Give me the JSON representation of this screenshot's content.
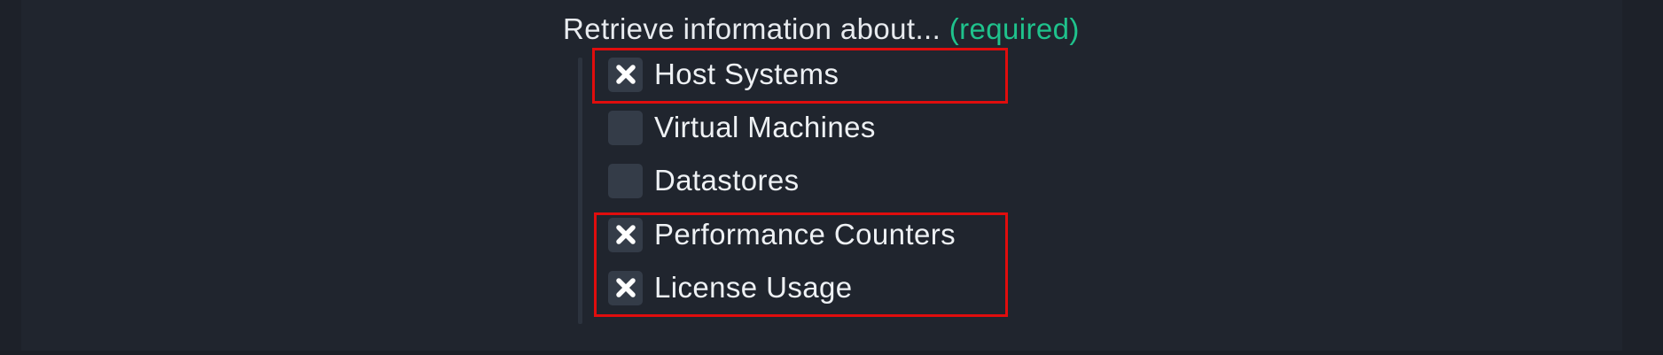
{
  "field": {
    "label": "Retrieve information about...",
    "required_tag": "(required)"
  },
  "options": [
    {
      "label": "Host Systems",
      "checked": true
    },
    {
      "label": "Virtual Machines",
      "checked": false
    },
    {
      "label": "Datastores",
      "checked": false
    },
    {
      "label": "Performance Counters",
      "checked": true
    },
    {
      "label": "License Usage",
      "checked": true
    }
  ],
  "icons": {
    "checked": "x-mark-icon"
  },
  "colors": {
    "background": "#20252e",
    "checkbox": "#343c48",
    "required": "#1fc28c",
    "highlight": "#e00d0d"
  }
}
